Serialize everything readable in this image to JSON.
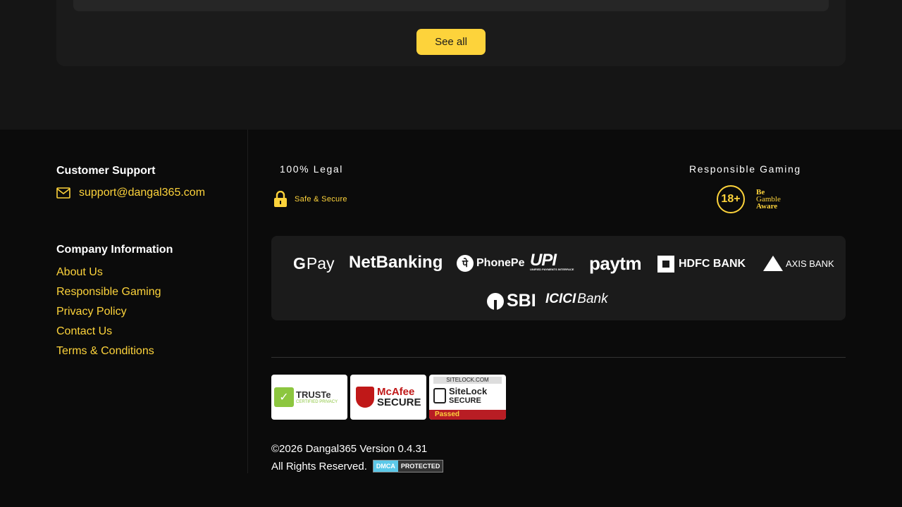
{
  "top": {
    "see_all_label": "See all"
  },
  "footer": {
    "customer_support": {
      "heading": "Customer Support",
      "email": "support@dangal365.com"
    },
    "company_information": {
      "heading": "Company Information",
      "links": [
        "About Us",
        "Responsible Gaming",
        "Privacy Policy",
        "Contact Us",
        "Terms & Conditions"
      ]
    },
    "legal": {
      "heading": "100% Legal",
      "safe_label": "Safe & Secure"
    },
    "responsible": {
      "heading": "Responsible Gaming",
      "age_badge": "18+",
      "gamble_aware": [
        "Be",
        "Gamble",
        "Aware"
      ]
    },
    "payments": {
      "gpay": "Pay",
      "netbanking": "NetBanking",
      "phonepe": "PhonePe",
      "upi": "UPI",
      "upi_sub": "UNIFIED PAYMENTS INTERFACE",
      "paytm": "paytm",
      "hdfc": "HDFC BANK",
      "axis": "AXIS BANK",
      "sbi": "SBI",
      "icici": "ICICI",
      "icici_bank": "Bank"
    },
    "trust_badges": {
      "truste": [
        "TRUSTe",
        "CERTIFIED PRIVACY"
      ],
      "mcafee": [
        "McAfee",
        "SECURE"
      ],
      "sitelock": [
        "SITELOCK.COM",
        "SiteLock",
        "SECURE",
        "Passed"
      ]
    },
    "copyright": "©2026 Dangal365 Version 0.4.31",
    "rights": "All Rights Reserved.",
    "dmca": [
      "DMCA",
      "PROTECTED"
    ]
  },
  "colors": {
    "accent": "#fdd33b",
    "background": "#0b0b0b",
    "panel": "#1b1b1b"
  }
}
